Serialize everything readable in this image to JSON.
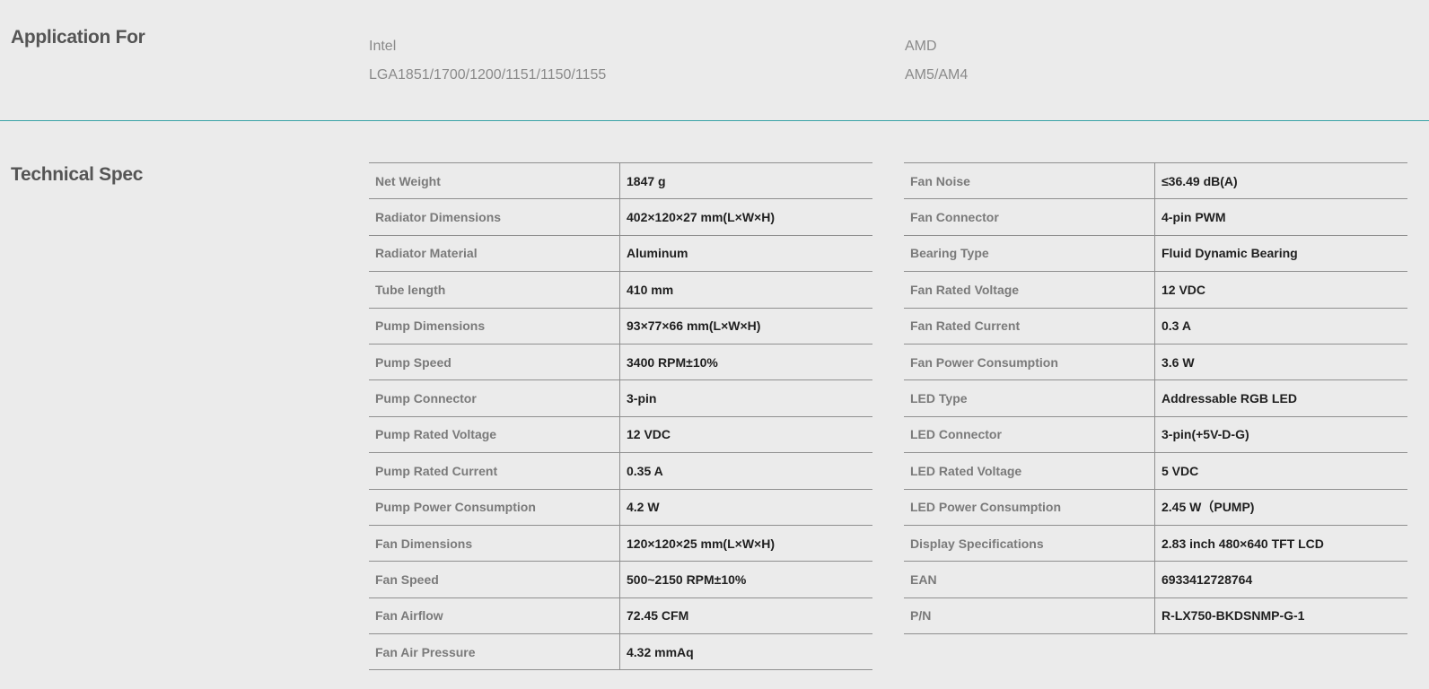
{
  "application": {
    "title": "Application For",
    "intel": {
      "brand": "Intel",
      "sockets": "LGA1851/1700/1200/1151/1150/1155"
    },
    "amd": {
      "brand": "AMD",
      "sockets": "AM5/AM4"
    }
  },
  "spec": {
    "title": "Technical Spec",
    "left": [
      {
        "label": "Net Weight",
        "value": "1847 g"
      },
      {
        "label": "Radiator Dimensions",
        "value": "402×120×27 mm(L×W×H)"
      },
      {
        "label": "Radiator Material",
        "value": "Aluminum"
      },
      {
        "label": "Tube length",
        "value": "410 mm"
      },
      {
        "label": "Pump Dimensions",
        "value": "93×77×66 mm(L×W×H)"
      },
      {
        "label": "Pump Speed",
        "value": "3400 RPM±10%"
      },
      {
        "label": "Pump Connector",
        "value": "3-pin"
      },
      {
        "label": "Pump Rated Voltage",
        "value": "12 VDC"
      },
      {
        "label": "Pump Rated Current",
        "value": "0.35 A"
      },
      {
        "label": "Pump Power Consumption",
        "value": "4.2 W"
      },
      {
        "label": "Fan Dimensions",
        "value": "120×120×25 mm(L×W×H)"
      },
      {
        "label": "Fan Speed",
        "value": "500~2150 RPM±10%"
      },
      {
        "label": "Fan Airflow",
        "value": "72.45 CFM"
      },
      {
        "label": "Fan Air Pressure",
        "value": "4.32 mmAq"
      }
    ],
    "right": [
      {
        "label": "Fan Noise",
        "value": "≤36.49 dB(A)"
      },
      {
        "label": "Fan Connector",
        "value": "4-pin PWM"
      },
      {
        "label": "Bearing Type",
        "value": "Fluid Dynamic Bearing"
      },
      {
        "label": "Fan Rated Voltage",
        "value": "12 VDC"
      },
      {
        "label": "Fan Rated Current",
        "value": "0.3 A"
      },
      {
        "label": "Fan Power Consumption",
        "value": "3.6 W"
      },
      {
        "label": "LED Type",
        "value": "Addressable RGB LED"
      },
      {
        "label": "LED Connector",
        "value": "3-pin(+5V-D-G)"
      },
      {
        "label": "LED Rated Voltage",
        "value": "5 VDC"
      },
      {
        "label": "LED Power Consumption",
        "value": "2.45 W（PUMP)"
      },
      {
        "label": "Display Specifications",
        "value": "2.83 inch 480×640 TFT LCD"
      },
      {
        "label": "EAN",
        "value": "6933412728764"
      },
      {
        "label": "P/N",
        "value": "R-LX750-BKDSNMP-G-1"
      }
    ]
  }
}
